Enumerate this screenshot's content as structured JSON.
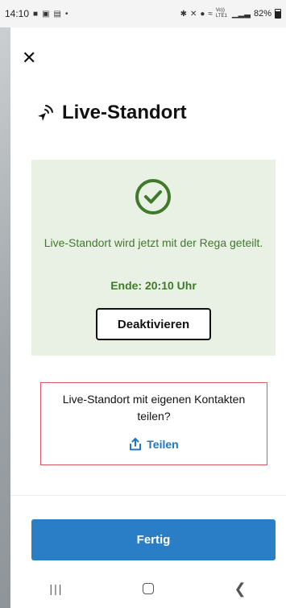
{
  "status_bar": {
    "time": "14:10",
    "battery": "82%",
    "network": "Vo)) LTE1"
  },
  "sheet": {
    "close_icon": "close-icon",
    "title": "Live-Standort",
    "title_icon": "location-arrow-broadcast-icon"
  },
  "status_panel": {
    "message": "Live-Standort wird jetzt mit der Rega geteilt.",
    "end_time": "Ende: 20:10 Uhr",
    "deactivate_label": "Deaktivieren",
    "accent_color": "#3f7a2b",
    "background_color": "#e8f1e4"
  },
  "share": {
    "question": "Live-Standort mit eigenen Kontakten teilen?",
    "button_label": "Teilen",
    "icon": "share-icon",
    "highlight_color": "#e05563"
  },
  "footer": {
    "done_label": "Fertig",
    "button_color": "#2a7ec6"
  },
  "nav": {
    "recents": "recents-icon",
    "home": "home-icon",
    "back": "back-icon"
  }
}
